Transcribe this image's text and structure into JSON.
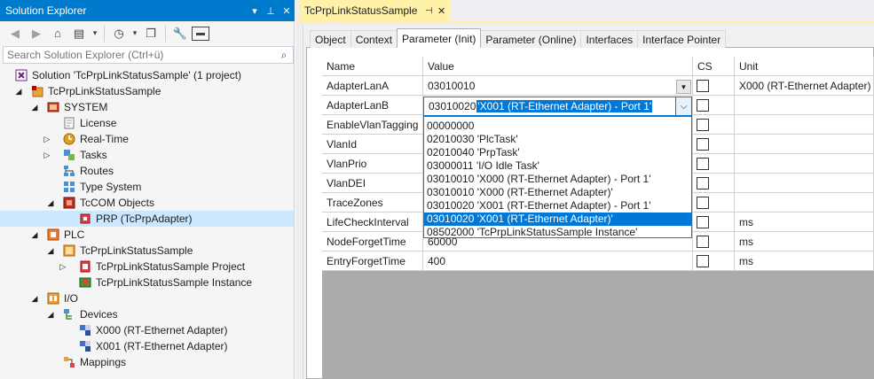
{
  "solution_explorer": {
    "title": "Solution Explorer",
    "search_placeholder": "Search Solution Explorer (Ctrl+ü)",
    "tree": [
      {
        "label": "Solution 'TcPrpLinkStatusSample' (1 project)",
        "icon": "solution-icon",
        "expander": ""
      },
      {
        "label": "TcPrpLinkStatusSample",
        "icon": "twincat-project-icon",
        "expander": "expanded"
      },
      {
        "label": "SYSTEM",
        "icon": "system-icon",
        "expander": "expanded"
      },
      {
        "label": "License",
        "icon": "license-icon",
        "expander": ""
      },
      {
        "label": "Real-Time",
        "icon": "realtime-icon",
        "expander": "collapsed"
      },
      {
        "label": "Tasks",
        "icon": "tasks-icon",
        "expander": "collapsed"
      },
      {
        "label": "Routes",
        "icon": "routes-icon",
        "expander": ""
      },
      {
        "label": "Type System",
        "icon": "type-system-icon",
        "expander": ""
      },
      {
        "label": "TcCOM Objects",
        "icon": "tccom-icon",
        "expander": "expanded"
      },
      {
        "label": "PRP (TcPrpAdapter)",
        "icon": "tccom-object-icon",
        "expander": ""
      },
      {
        "label": "PLC",
        "icon": "plc-icon",
        "expander": "expanded"
      },
      {
        "label": "TcPrpLinkStatusSample",
        "icon": "plc-project-icon",
        "expander": "expanded"
      },
      {
        "label": "TcPrpLinkStatusSample Project",
        "icon": "plc-project-file-icon",
        "expander": "collapsed"
      },
      {
        "label": "TcPrpLinkStatusSample Instance",
        "icon": "plc-instance-icon",
        "expander": ""
      },
      {
        "label": "I/O",
        "icon": "io-icon",
        "expander": "expanded"
      },
      {
        "label": "Devices",
        "icon": "devices-icon",
        "expander": "expanded"
      },
      {
        "label": "X000 (RT-Ethernet Adapter)",
        "icon": "ethernet-adapter-icon",
        "expander": ""
      },
      {
        "label": "X001 (RT-Ethernet Adapter)",
        "icon": "ethernet-adapter-icon",
        "expander": ""
      },
      {
        "label": "Mappings",
        "icon": "mappings-icon",
        "expander": ""
      }
    ]
  },
  "document": {
    "tab_title": "TcPrpLinkStatusSample",
    "tabs": [
      "Object",
      "Context",
      "Parameter (Init)",
      "Parameter (Online)",
      "Interfaces",
      "Interface Pointer"
    ],
    "active_tab": "Parameter (Init)",
    "grid": {
      "headers": {
        "name": "Name",
        "value": "Value",
        "cs": "CS",
        "unit": "Unit"
      },
      "rows": [
        {
          "name": "AdapterLanA",
          "value": "03010010",
          "unit": "X000 (RT-Ethernet Adapter)"
        },
        {
          "name": "AdapterLanB",
          "value": "",
          "unit": ""
        },
        {
          "name": "EnableVlanTagging",
          "value": "",
          "unit": ""
        },
        {
          "name": "VlanId",
          "value": "",
          "unit": ""
        },
        {
          "name": "VlanPrio",
          "value": "",
          "unit": ""
        },
        {
          "name": "VlanDEI",
          "value": "",
          "unit": ""
        },
        {
          "name": "TraceZones",
          "value": "",
          "unit": ""
        },
        {
          "name": "LifeCheckInterval",
          "value": "",
          "unit": "ms"
        },
        {
          "name": "NodeForgetTime",
          "value": "60000",
          "unit": "ms"
        },
        {
          "name": "EntryForgetTime",
          "value": "400",
          "unit": "ms"
        }
      ],
      "editing": {
        "number": "03010020",
        "selected_text": "'X001 (RT-Ethernet Adapter) - Port 1'"
      },
      "dropdown_options": [
        "00000000",
        "02010030 'PlcTask'",
        "02010040 'PrpTask'",
        "03000011 'I/O Idle Task'",
        "03010010 'X000 (RT-Ethernet Adapter) - Port 1'",
        "03010010 'X000 (RT-Ethernet Adapter)'",
        "03010020 'X001 (RT-Ethernet Adapter) - Port 1'",
        "03010020 'X001 (RT-Ethernet Adapter)'",
        "08502000 'TcPrpLinkStatusSample Instance'"
      ],
      "dropdown_selected_index": 7
    }
  },
  "colors": {
    "title_bar": "#007acc",
    "doc_tab": "#fff1a8",
    "selection": "#0078d7",
    "tree_selection": "#cce8ff"
  }
}
